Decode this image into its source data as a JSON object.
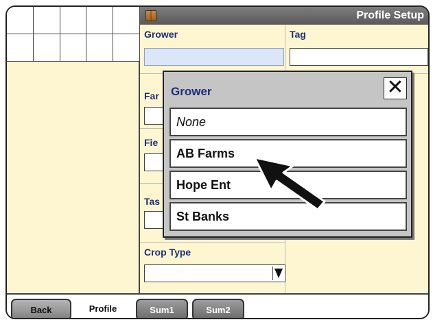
{
  "window": {
    "title": "Profile Setup"
  },
  "form": {
    "grower_label": "Grower",
    "tag_label": "Tag",
    "farm_label_partial": "Far",
    "field_label_partial": "Fie",
    "task_label_partial": "Tas",
    "crop_type_label": "Crop Type"
  },
  "popup": {
    "title": "Grower",
    "close_symbol": "✕",
    "options": [
      "None",
      "AB Farms",
      "Hope Ent",
      "St Banks"
    ]
  },
  "tabs": {
    "back": "Back",
    "profile": "Profile",
    "sum1": "Sum1",
    "sum2": "Sum2"
  }
}
